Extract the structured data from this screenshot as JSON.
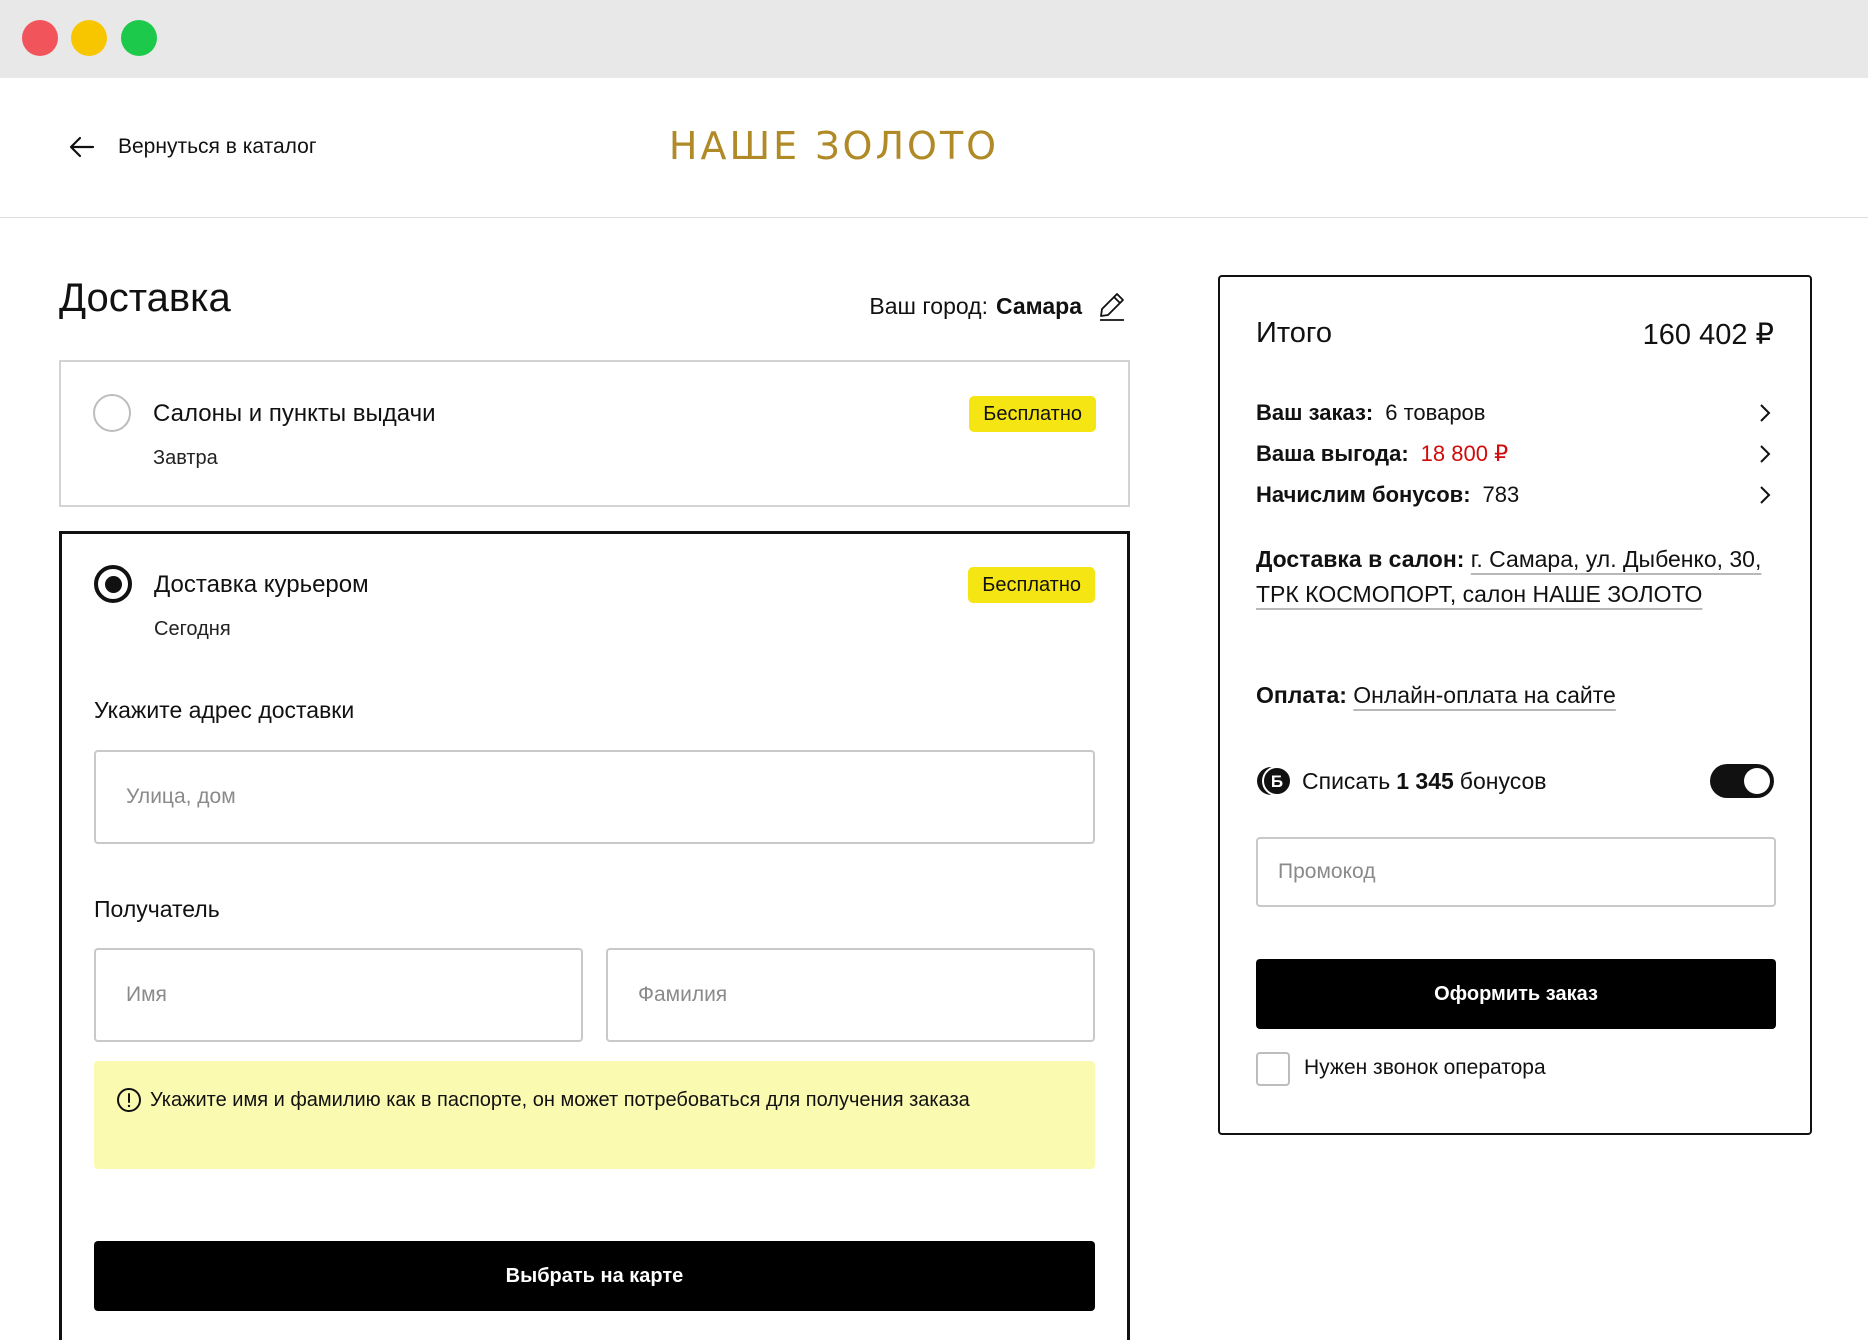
{
  "header": {
    "back_label": "Вернуться в каталог",
    "logo": "НАШЕ ЗОЛОТО",
    "logo_color": "#b08a26"
  },
  "delivery": {
    "title": "Доставка",
    "city_label": "Ваш город:",
    "city_value": "Самара",
    "options": [
      {
        "title": "Салоны и пункты выдачи",
        "subtitle": "Завтра",
        "badge": "Бесплатно",
        "selected": false
      },
      {
        "title": "Доставка курьером",
        "subtitle": "Сегодня",
        "badge": "Бесплатно",
        "selected": true
      }
    ],
    "address_label": "Укажите адрес доставки",
    "address_placeholder": "Улица, дом",
    "recipient_label": "Получатель",
    "first_name_placeholder": "Имя",
    "last_name_placeholder": "Фамилия",
    "hint": "Укажите имя и фамилию как в паспорте, он может потребоваться для получения заказа",
    "map_button": "Выбрать на карте"
  },
  "summary": {
    "title": "Итого",
    "total": "160 402 ₽",
    "order_label": "Ваш заказ:",
    "order_value": "6 товаров",
    "savings_label": "Ваша выгода:",
    "savings_value": "18 800 ₽",
    "bonus_label": "Начислим бонусов:",
    "bonus_value": "783",
    "delivery_label": "Доставка в салон:",
    "delivery_value": "г. Самара, ул. Дыбенко, 30, ТРК КОСМОПОРТ, салон НАШЕ ЗОЛОТО",
    "payment_label": "Оплата:",
    "payment_value": "Онлайн-оплата на сайте",
    "writeoff_prefix": "Списать",
    "writeoff_amount": "1 345",
    "writeoff_suffix": "бонусов",
    "writeoff_enabled": true,
    "bonus_icon_letter": "Б",
    "promo_placeholder": "Промокод",
    "submit_button": "Оформить заказ",
    "operator_call_label": "Нужен звонок оператора",
    "operator_call_checked": false,
    "accent_red": "#d10a0a",
    "badge_yellow": "#f5e513",
    "hint_bg": "#fafab1"
  }
}
